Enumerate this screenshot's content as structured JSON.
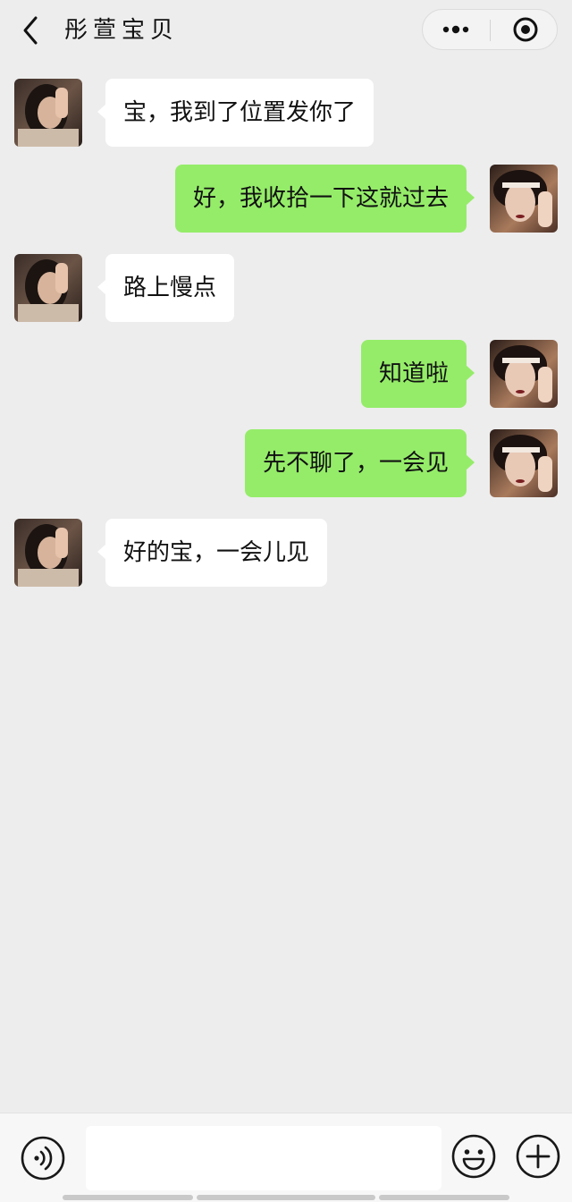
{
  "header": {
    "title": "彤萱宝贝",
    "back_icon": "chevron-left-icon",
    "more_icon": "more-dots-icon",
    "target_icon": "target-icon"
  },
  "colors": {
    "background": "#ededed",
    "bubble_self": "#95ec69",
    "bubble_other": "#ffffff",
    "text": "#111111"
  },
  "messages": [
    {
      "sender": "other",
      "text": "宝，我到了位置发你了"
    },
    {
      "sender": "self",
      "text": "好，我收拾一下这就过去"
    },
    {
      "sender": "other",
      "text": "路上慢点"
    },
    {
      "sender": "self",
      "text": "知道啦"
    },
    {
      "sender": "self",
      "text": "先不聊了，一会见"
    },
    {
      "sender": "other",
      "text": "好的宝，一会儿见"
    }
  ],
  "input_bar": {
    "voice_icon": "voice-icon",
    "text_value": "",
    "emoji_icon": "emoji-icon",
    "plus_icon": "plus-icon"
  }
}
